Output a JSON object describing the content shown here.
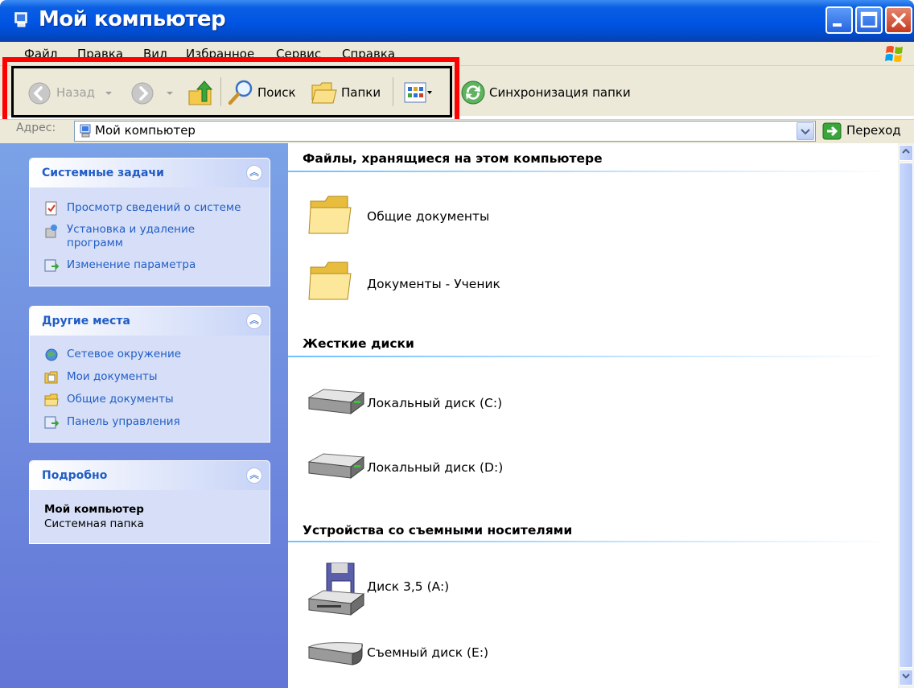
{
  "window": {
    "title": "Мой компьютер"
  },
  "menu": [
    "Файл",
    "Правка",
    "Вид",
    "Избранное",
    "Сервис",
    "Справка"
  ],
  "toolbar": {
    "back_label": "Назад",
    "search_label": "Поиск",
    "folders_label": "Папки",
    "sync_label": "Синхронизация папки"
  },
  "address": {
    "label": "Адрес:",
    "value": "Мой компьютер",
    "go_label": "Переход"
  },
  "tasks": {
    "system": {
      "title": "Системные задачи",
      "items": [
        {
          "label": "Просмотр сведений о системе",
          "icon": "system-info-icon"
        },
        {
          "label": "Установка и удаление\nпрограмм",
          "icon": "add-remove-programs-icon"
        },
        {
          "label": "Изменение параметра",
          "icon": "change-setting-icon"
        }
      ]
    },
    "places": {
      "title": "Другие места",
      "items": [
        {
          "label": "Сетевое окружение",
          "icon": "network-icon"
        },
        {
          "label": "Мои документы",
          "icon": "my-documents-icon"
        },
        {
          "label": "Общие документы",
          "icon": "shared-documents-icon"
        },
        {
          "label": "Панель управления",
          "icon": "control-panel-icon"
        }
      ]
    },
    "details": {
      "title": "Подробно",
      "name": "Мой компьютер",
      "type": "Системная папка"
    }
  },
  "groups": [
    {
      "title": "Файлы, хранящиеся на этом компьютере",
      "items": [
        {
          "label": "Общие документы",
          "icon": "folder-icon"
        },
        {
          "label": "Документы - Ученик",
          "icon": "folder-icon"
        }
      ]
    },
    {
      "title": "Жесткие диски",
      "items": [
        {
          "label": "Локальный диск (C:)",
          "icon": "hard-drive-icon"
        },
        {
          "label": "Локальный диск (D:)",
          "icon": "hard-drive-icon"
        }
      ]
    },
    {
      "title": "Устройства со съемными носителями",
      "items": [
        {
          "label": "Диск 3,5 (A:)",
          "icon": "floppy-drive-icon"
        },
        {
          "label": "Съемный диск (E:)",
          "icon": "removable-drive-icon"
        }
      ]
    }
  ],
  "colors": {
    "titlebar": "#0054e3",
    "highlight": "#ff0000",
    "task_link": "#215dc6",
    "pane": "#6375d6"
  }
}
